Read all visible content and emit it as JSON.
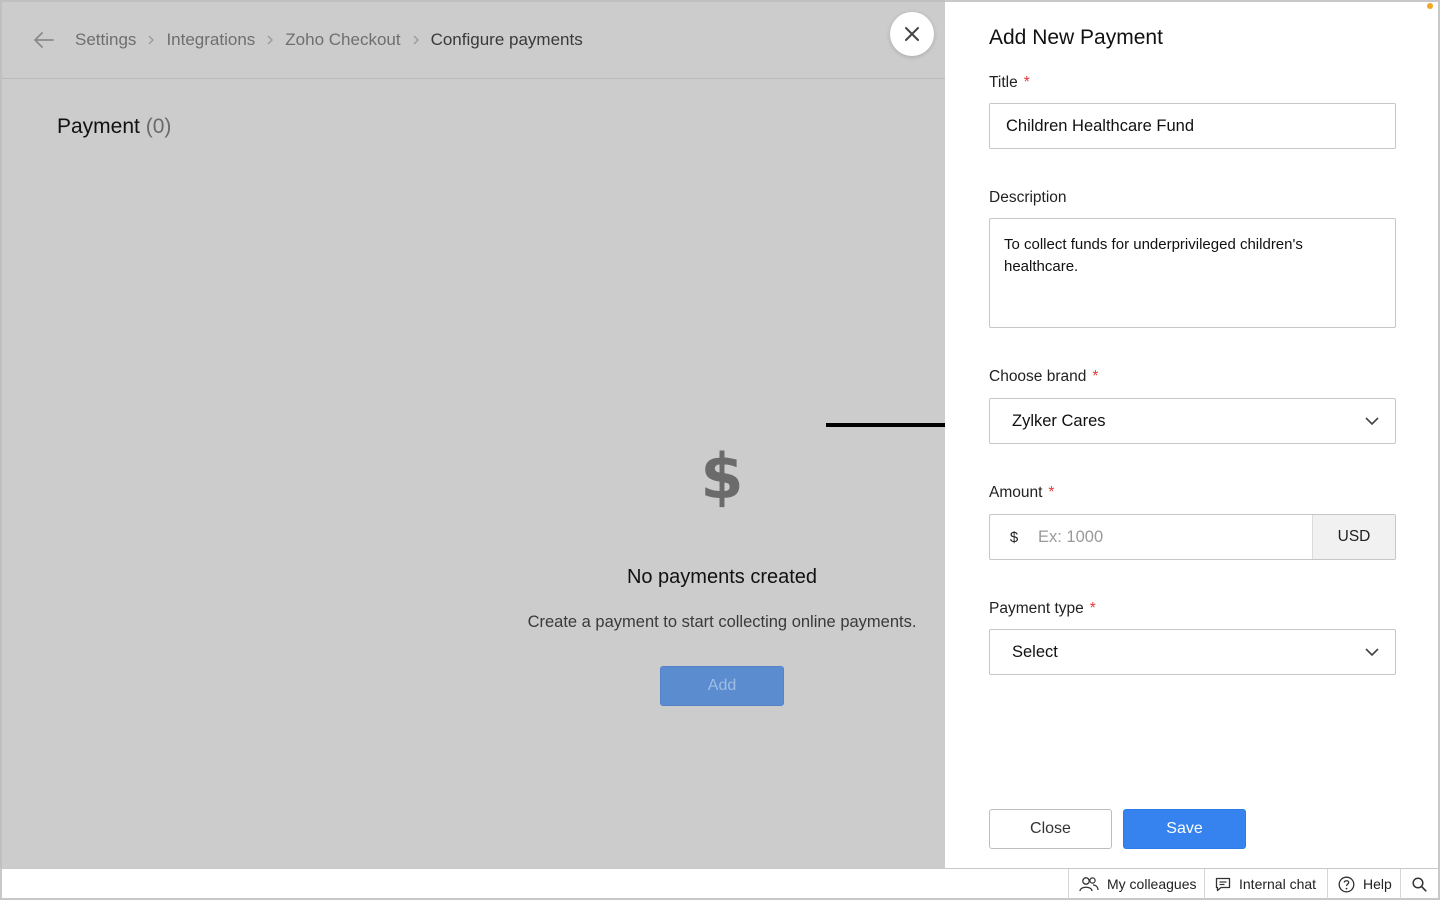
{
  "breadcrumb": [
    "Settings",
    "Integrations",
    "Zoho Checkout",
    "Configure payments"
  ],
  "section": {
    "title": "Payment",
    "count": "(0)"
  },
  "empty_state": {
    "icon": "$",
    "title": "No payments created",
    "description": "Create a payment to start collecting online payments.",
    "add_label": "Add"
  },
  "form": {
    "title": "Add New Payment",
    "title_label": "Title",
    "title_value": "Children Healthcare Fund",
    "description_label": "Description",
    "description_value": "To collect funds for underprivileged children's healthcare.",
    "brand_label": "Choose brand",
    "brand_value": "Zylker Cares",
    "amount_label": "Amount",
    "amount_symbol": "$",
    "amount_placeholder": "Ex: 1000",
    "currency": "USD",
    "payment_type_label": "Payment type",
    "payment_type_value": "Select",
    "required_mark": "*",
    "close_label": "Close",
    "save_label": "Save"
  },
  "bottom_bar": {
    "colleagues": "My colleagues",
    "chat": "Internal chat",
    "help": "Help"
  },
  "colors": {
    "accent": "#3683f0",
    "required": "#e23b3b",
    "overlay": "#cccccc"
  }
}
